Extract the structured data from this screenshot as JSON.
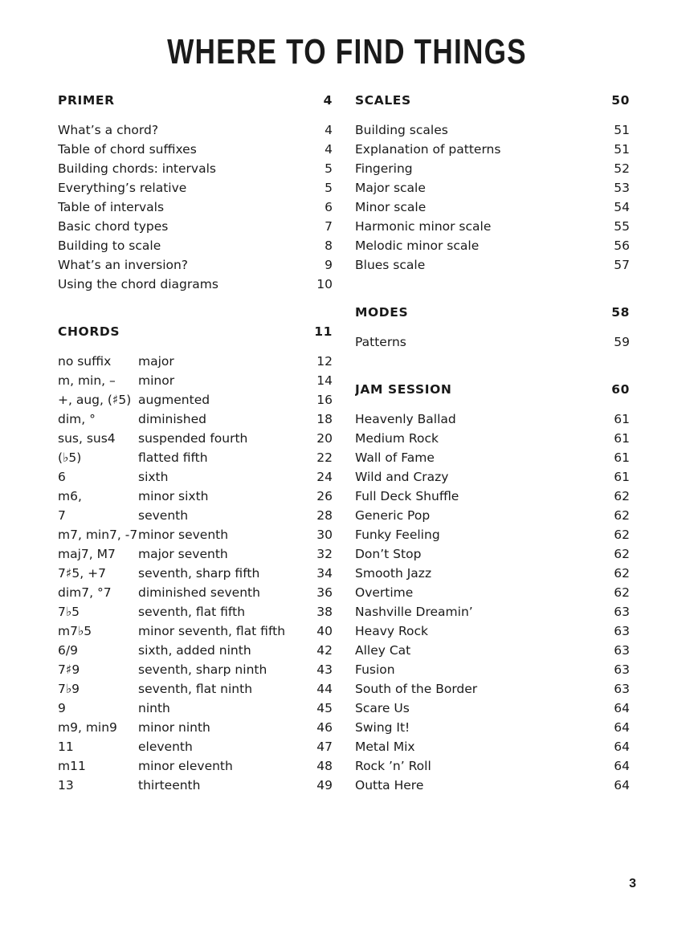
{
  "page": {
    "title": "WHERE TO FIND THINGS",
    "folio": "3"
  },
  "left_column": {
    "sections": [
      {
        "header": {
          "label": "PRIMER",
          "page": "4"
        },
        "type": "simple",
        "entries": [
          {
            "label": "What’s a chord?",
            "page": "4"
          },
          {
            "label": "Table of chord suffixes",
            "page": "4"
          },
          {
            "label": "Building chords: intervals",
            "page": "5"
          },
          {
            "label": "Everything’s relative",
            "page": "5"
          },
          {
            "label": "Table of intervals",
            "page": "6"
          },
          {
            "label": "Basic chord types",
            "page": "7"
          },
          {
            "label": "Building to scale",
            "page": "8"
          },
          {
            "label": "What’s an inversion?",
            "page": "9"
          },
          {
            "label": "Using the chord diagrams",
            "page": "10"
          }
        ]
      },
      {
        "header": {
          "label": "CHORDS",
          "page": "11"
        },
        "type": "chords",
        "entries": [
          {
            "suffix": "no suffix",
            "desc": "major",
            "page": "12"
          },
          {
            "suffix": "m, min, –",
            "desc": "minor",
            "page": "14"
          },
          {
            "suffix": "+, aug, (♯5)",
            "desc": "augmented",
            "page": "16"
          },
          {
            "suffix": "dim, °",
            "desc": "diminished",
            "page": "18"
          },
          {
            "suffix": "sus, sus4",
            "desc": "suspended fourth",
            "page": "20"
          },
          {
            "suffix": "(♭5)",
            "desc": "flatted fifth",
            "page": "22"
          },
          {
            "suffix": "6",
            "desc": "sixth",
            "page": "24"
          },
          {
            "suffix": "m6,",
            "desc": "minor sixth",
            "page": "26"
          },
          {
            "suffix": "7",
            "desc": "seventh",
            "page": "28"
          },
          {
            "suffix": "m7, min7, -7",
            "desc": "minor seventh",
            "page": "30"
          },
          {
            "suffix": "maj7, M7",
            "desc": "major seventh",
            "page": "32"
          },
          {
            "suffix": "7♯5, +7",
            "desc": "seventh, sharp fifth",
            "page": "34"
          },
          {
            "suffix": "dim7, °7",
            "desc": "diminished seventh",
            "page": "36"
          },
          {
            "suffix": "7♭5",
            "desc": "seventh, flat fifth",
            "page": "38"
          },
          {
            "suffix": "m7♭5",
            "desc": "minor seventh, flat fifth",
            "page": "40"
          },
          {
            "suffix": "6/9",
            "desc": "sixth, added ninth",
            "page": "42"
          },
          {
            "suffix": "7♯9",
            "desc": "seventh, sharp ninth",
            "page": "43"
          },
          {
            "suffix": "7♭9",
            "desc": "seventh, flat ninth",
            "page": "44"
          },
          {
            "suffix": "9",
            "desc": "ninth",
            "page": "45"
          },
          {
            "suffix": "m9, min9",
            "desc": "minor ninth",
            "page": "46"
          },
          {
            "suffix": "11",
            "desc": "eleventh",
            "page": "47"
          },
          {
            "suffix": "m11",
            "desc": "minor eleventh",
            "page": "48"
          },
          {
            "suffix": "13",
            "desc": "thirteenth",
            "page": "49"
          }
        ]
      }
    ]
  },
  "right_column": {
    "sections": [
      {
        "header": {
          "label": "SCALES",
          "page": "50"
        },
        "type": "simple",
        "entries": [
          {
            "label": "Building scales",
            "page": "51"
          },
          {
            "label": "Explanation of patterns",
            "page": "51"
          },
          {
            "label": "Fingering",
            "page": "52"
          },
          {
            "label": "Major scale",
            "page": "53"
          },
          {
            "label": "Minor scale",
            "page": "54"
          },
          {
            "label": "Harmonic minor scale",
            "page": "55"
          },
          {
            "label": "Melodic minor scale",
            "page": "56"
          },
          {
            "label": "Blues scale",
            "page": "57"
          }
        ]
      },
      {
        "header": {
          "label": "MODES",
          "page": "58"
        },
        "type": "simple",
        "entries": [
          {
            "label": "Patterns",
            "page": "59"
          }
        ]
      },
      {
        "header": {
          "label": "JAM SESSION",
          "page": "60"
        },
        "type": "simple",
        "entries": [
          {
            "label": "Heavenly Ballad",
            "page": "61"
          },
          {
            "label": "Medium Rock",
            "page": "61"
          },
          {
            "label": "Wall of Fame",
            "page": "61"
          },
          {
            "label": "Wild and Crazy",
            "page": "61"
          },
          {
            "label": "Full Deck Shuffle",
            "page": "62"
          },
          {
            "label": "Generic Pop",
            "page": "62"
          },
          {
            "label": "Funky Feeling",
            "page": "62"
          },
          {
            "label": "Don’t Stop",
            "page": "62"
          },
          {
            "label": "Smooth Jazz",
            "page": "62"
          },
          {
            "label": "Overtime",
            "page": "62"
          },
          {
            "label": "Nashville Dreamin’",
            "page": "63"
          },
          {
            "label": "Heavy Rock",
            "page": "63"
          },
          {
            "label": "Alley Cat",
            "page": "63"
          },
          {
            "label": "Fusion",
            "page": "63"
          },
          {
            "label": "South of the Border",
            "page": "63"
          },
          {
            "label": "Scare Us",
            "page": "64"
          },
          {
            "label": "Swing It!",
            "page": "64"
          },
          {
            "label": "Metal Mix",
            "page": "64"
          },
          {
            "label": "Rock ’n’ Roll",
            "page": "64"
          },
          {
            "label": "Outta Here",
            "page": "64"
          }
        ]
      }
    ]
  }
}
